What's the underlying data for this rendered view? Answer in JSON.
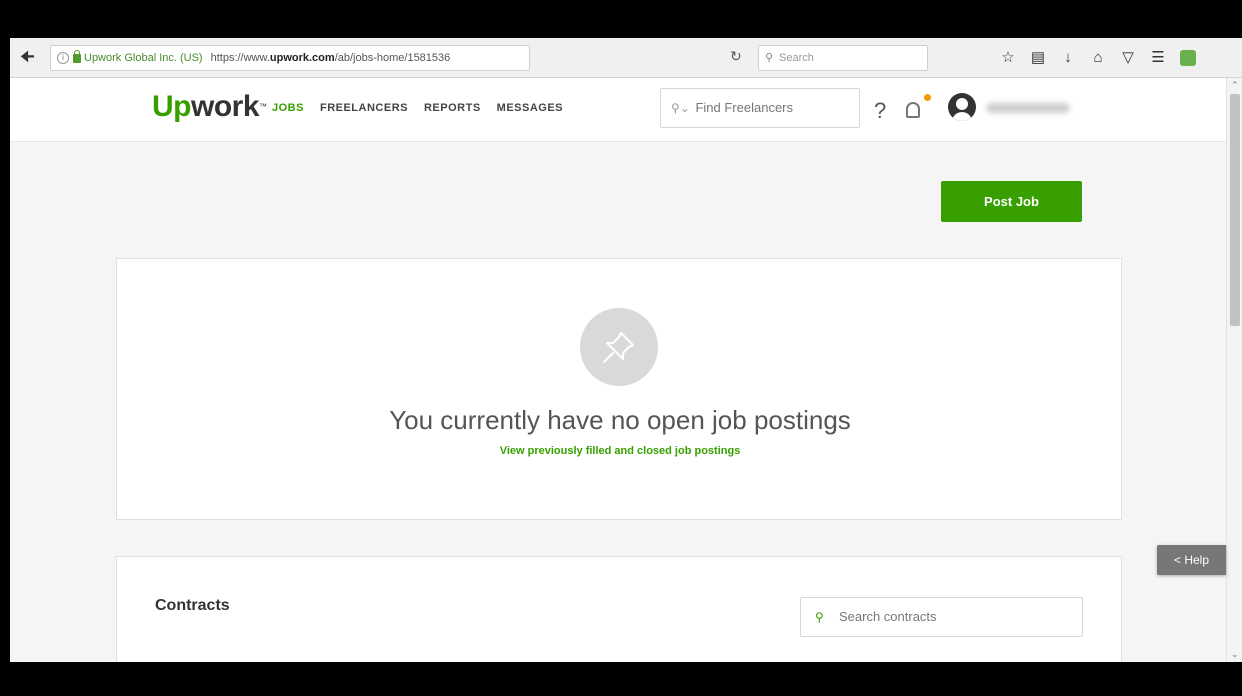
{
  "browser": {
    "back_icon": "arrow-left-icon",
    "identity": "Upwork Global Inc. (US)",
    "url_prefix": "https://www.",
    "url_domain": "upwork.com",
    "url_path": "/ab/jobs-home/1581536",
    "search_placeholder": "Search",
    "toolbar_icons": [
      "star-icon",
      "clipboard-icon",
      "download-icon",
      "home-icon",
      "pocket-icon",
      "menu-icon",
      "extension-icon"
    ]
  },
  "header": {
    "logo_up": "Up",
    "logo_work": "work",
    "logo_tm": "™",
    "nav": [
      {
        "label": "JOBS",
        "active": true
      },
      {
        "label": "FREELANCERS",
        "active": false
      },
      {
        "label": "REPORTS",
        "active": false
      },
      {
        "label": "MESSAGES",
        "active": false
      }
    ],
    "find_placeholder": "Find Freelancers",
    "help_glyph": "?"
  },
  "main": {
    "post_job_label": "Post Job",
    "empty_title": "You currently have no open job postings",
    "empty_link": "View previously filled and closed job postings",
    "contracts_title": "Contracts",
    "contracts_search_placeholder": "Search contracts",
    "help_tab_label": "< Help"
  },
  "colors": {
    "brand_green": "#37a000",
    "notification_dot": "#f29a00"
  }
}
